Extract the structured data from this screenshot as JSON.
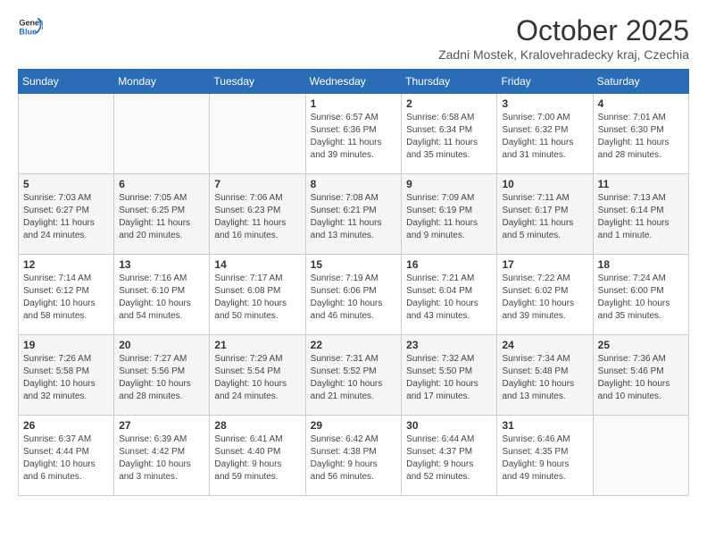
{
  "logo": {
    "line1": "General",
    "line2": "Blue"
  },
  "title": "October 2025",
  "subtitle": "Zadni Mostek, Kralovehradecky kraj, Czechia",
  "headers": [
    "Sunday",
    "Monday",
    "Tuesday",
    "Wednesday",
    "Thursday",
    "Friday",
    "Saturday"
  ],
  "weeks": [
    [
      {
        "day": "",
        "info": ""
      },
      {
        "day": "",
        "info": ""
      },
      {
        "day": "",
        "info": ""
      },
      {
        "day": "1",
        "info": "Sunrise: 6:57 AM\nSunset: 6:36 PM\nDaylight: 11 hours\nand 39 minutes."
      },
      {
        "day": "2",
        "info": "Sunrise: 6:58 AM\nSunset: 6:34 PM\nDaylight: 11 hours\nand 35 minutes."
      },
      {
        "day": "3",
        "info": "Sunrise: 7:00 AM\nSunset: 6:32 PM\nDaylight: 11 hours\nand 31 minutes."
      },
      {
        "day": "4",
        "info": "Sunrise: 7:01 AM\nSunset: 6:30 PM\nDaylight: 11 hours\nand 28 minutes."
      }
    ],
    [
      {
        "day": "5",
        "info": "Sunrise: 7:03 AM\nSunset: 6:27 PM\nDaylight: 11 hours\nand 24 minutes."
      },
      {
        "day": "6",
        "info": "Sunrise: 7:05 AM\nSunset: 6:25 PM\nDaylight: 11 hours\nand 20 minutes."
      },
      {
        "day": "7",
        "info": "Sunrise: 7:06 AM\nSunset: 6:23 PM\nDaylight: 11 hours\nand 16 minutes."
      },
      {
        "day": "8",
        "info": "Sunrise: 7:08 AM\nSunset: 6:21 PM\nDaylight: 11 hours\nand 13 minutes."
      },
      {
        "day": "9",
        "info": "Sunrise: 7:09 AM\nSunset: 6:19 PM\nDaylight: 11 hours\nand 9 minutes."
      },
      {
        "day": "10",
        "info": "Sunrise: 7:11 AM\nSunset: 6:17 PM\nDaylight: 11 hours\nand 5 minutes."
      },
      {
        "day": "11",
        "info": "Sunrise: 7:13 AM\nSunset: 6:14 PM\nDaylight: 11 hours\nand 1 minute."
      }
    ],
    [
      {
        "day": "12",
        "info": "Sunrise: 7:14 AM\nSunset: 6:12 PM\nDaylight: 10 hours\nand 58 minutes."
      },
      {
        "day": "13",
        "info": "Sunrise: 7:16 AM\nSunset: 6:10 PM\nDaylight: 10 hours\nand 54 minutes."
      },
      {
        "day": "14",
        "info": "Sunrise: 7:17 AM\nSunset: 6:08 PM\nDaylight: 10 hours\nand 50 minutes."
      },
      {
        "day": "15",
        "info": "Sunrise: 7:19 AM\nSunset: 6:06 PM\nDaylight: 10 hours\nand 46 minutes."
      },
      {
        "day": "16",
        "info": "Sunrise: 7:21 AM\nSunset: 6:04 PM\nDaylight: 10 hours\nand 43 minutes."
      },
      {
        "day": "17",
        "info": "Sunrise: 7:22 AM\nSunset: 6:02 PM\nDaylight: 10 hours\nand 39 minutes."
      },
      {
        "day": "18",
        "info": "Sunrise: 7:24 AM\nSunset: 6:00 PM\nDaylight: 10 hours\nand 35 minutes."
      }
    ],
    [
      {
        "day": "19",
        "info": "Sunrise: 7:26 AM\nSunset: 5:58 PM\nDaylight: 10 hours\nand 32 minutes."
      },
      {
        "day": "20",
        "info": "Sunrise: 7:27 AM\nSunset: 5:56 PM\nDaylight: 10 hours\nand 28 minutes."
      },
      {
        "day": "21",
        "info": "Sunrise: 7:29 AM\nSunset: 5:54 PM\nDaylight: 10 hours\nand 24 minutes."
      },
      {
        "day": "22",
        "info": "Sunrise: 7:31 AM\nSunset: 5:52 PM\nDaylight: 10 hours\nand 21 minutes."
      },
      {
        "day": "23",
        "info": "Sunrise: 7:32 AM\nSunset: 5:50 PM\nDaylight: 10 hours\nand 17 minutes."
      },
      {
        "day": "24",
        "info": "Sunrise: 7:34 AM\nSunset: 5:48 PM\nDaylight: 10 hours\nand 13 minutes."
      },
      {
        "day": "25",
        "info": "Sunrise: 7:36 AM\nSunset: 5:46 PM\nDaylight: 10 hours\nand 10 minutes."
      }
    ],
    [
      {
        "day": "26",
        "info": "Sunrise: 6:37 AM\nSunset: 4:44 PM\nDaylight: 10 hours\nand 6 minutes."
      },
      {
        "day": "27",
        "info": "Sunrise: 6:39 AM\nSunset: 4:42 PM\nDaylight: 10 hours\nand 3 minutes."
      },
      {
        "day": "28",
        "info": "Sunrise: 6:41 AM\nSunset: 4:40 PM\nDaylight: 9 hours\nand 59 minutes."
      },
      {
        "day": "29",
        "info": "Sunrise: 6:42 AM\nSunset: 4:38 PM\nDaylight: 9 hours\nand 56 minutes."
      },
      {
        "day": "30",
        "info": "Sunrise: 6:44 AM\nSunset: 4:37 PM\nDaylight: 9 hours\nand 52 minutes."
      },
      {
        "day": "31",
        "info": "Sunrise: 6:46 AM\nSunset: 4:35 PM\nDaylight: 9 hours\nand 49 minutes."
      },
      {
        "day": "",
        "info": ""
      }
    ]
  ]
}
